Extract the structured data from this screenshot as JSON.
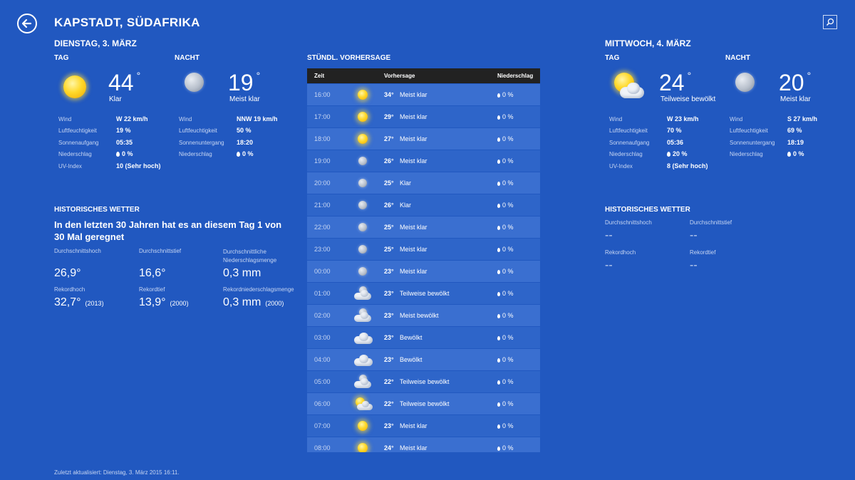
{
  "header": {
    "title": "KAPSTADT, SÜDAFRIKA"
  },
  "today": {
    "date": "DIENSTAG, 3. MÄRZ",
    "day": {
      "label": "TAG",
      "temp": "44",
      "deg": "°",
      "cond": "Klar"
    },
    "night": {
      "label": "NACHT",
      "temp": "19",
      "deg": "°",
      "cond": "Meist klar"
    },
    "day_details": [
      {
        "label": "Wind",
        "value": "W 22 km/h"
      },
      {
        "label": "Luftfeuchtigkeit",
        "value": "19 %"
      },
      {
        "label": "Sonnenaufgang",
        "value": "05:35"
      },
      {
        "label": "Niederschlag",
        "value": "0 %"
      },
      {
        "label": "UV-Index",
        "value": "10 (Sehr hoch)"
      }
    ],
    "night_details": [
      {
        "label": "Wind",
        "value": "NNW 19 km/h"
      },
      {
        "label": "Luftfeuchtigkeit",
        "value": "50 %"
      },
      {
        "label": "Sonnenuntergang",
        "value": "18:20"
      },
      {
        "label": "Niederschlag",
        "value": "0 %"
      }
    ]
  },
  "history": {
    "title": "HISTORISCHES WETTER",
    "headline": "In den letzten 30 Jahren hat es an diesem Tag 1 von 30 Mal geregnet",
    "avg_high": {
      "label": "Durchschnittshoch",
      "value": "26,9°"
    },
    "avg_low": {
      "label": "Durchschnittstief",
      "value": "16,6°"
    },
    "avg_precip": {
      "label": "Durchschnittliche Niederschlagsmenge",
      "value": "0,3 mm"
    },
    "rec_high": {
      "label": "Rekordhoch",
      "value": "32,7°",
      "year": "(2013)"
    },
    "rec_low": {
      "label": "Rekordtief",
      "value": "13,9°",
      "year": "(2000)"
    },
    "rec_precip": {
      "label": "Rekordniederschlagsmenge",
      "value": "0,3 mm",
      "year": "(2000)"
    }
  },
  "hourly": {
    "title": "STÜNDL. VORHERSAGE",
    "cols": {
      "time": "Zeit",
      "forecast": "Vorhersage",
      "precip": "Niederschlag"
    },
    "rows": [
      {
        "time": "16:00",
        "icon": "sun-icon",
        "temp": "34°",
        "cond": "Meist klar",
        "precip": "0 %"
      },
      {
        "time": "17:00",
        "icon": "sun-icon",
        "temp": "29°",
        "cond": "Meist klar",
        "precip": "0 %"
      },
      {
        "time": "18:00",
        "icon": "sun-icon",
        "temp": "27°",
        "cond": "Meist klar",
        "precip": "0 %"
      },
      {
        "time": "19:00",
        "icon": "moon-icon",
        "temp": "26°",
        "cond": "Meist klar",
        "precip": "0 %"
      },
      {
        "time": "20:00",
        "icon": "moon-icon",
        "temp": "25°",
        "cond": "Klar",
        "precip": "0 %"
      },
      {
        "time": "21:00",
        "icon": "moon-icon",
        "temp": "26°",
        "cond": "Klar",
        "precip": "0 %"
      },
      {
        "time": "22:00",
        "icon": "moon-icon",
        "temp": "25°",
        "cond": "Meist klar",
        "precip": "0 %"
      },
      {
        "time": "23:00",
        "icon": "moon-icon",
        "temp": "25°",
        "cond": "Meist klar",
        "precip": "0 %"
      },
      {
        "time": "00:00",
        "icon": "moon-icon",
        "temp": "23°",
        "cond": "Meist klar",
        "precip": "0 %"
      },
      {
        "time": "01:00",
        "icon": "moon-cloud-icon",
        "temp": "23°",
        "cond": "Teilweise bewölkt",
        "precip": "0 %"
      },
      {
        "time": "02:00",
        "icon": "moon-cloud-icon",
        "temp": "23°",
        "cond": "Meist bewölkt",
        "precip": "0 %"
      },
      {
        "time": "03:00",
        "icon": "cloud-icon",
        "temp": "23°",
        "cond": "Bewölkt",
        "precip": "0 %"
      },
      {
        "time": "04:00",
        "icon": "cloud-icon",
        "temp": "23°",
        "cond": "Bewölkt",
        "precip": "0 %"
      },
      {
        "time": "05:00",
        "icon": "moon-cloud-icon",
        "temp": "22°",
        "cond": "Teilweise bewölkt",
        "precip": "0 %"
      },
      {
        "time": "06:00",
        "icon": "sun-cloud-icon",
        "temp": "22°",
        "cond": "Teilweise bewölkt",
        "precip": "0 %"
      },
      {
        "time": "07:00",
        "icon": "sun-icon",
        "temp": "23°",
        "cond": "Meist klar",
        "precip": "0 %"
      },
      {
        "time": "08:00",
        "icon": "sun-icon",
        "temp": "24°",
        "cond": "Meist klar",
        "precip": "0 %"
      }
    ]
  },
  "tomorrow": {
    "date": "MITTWOCH, 4. MÄRZ",
    "day": {
      "label": "TAG",
      "temp": "24",
      "deg": "°",
      "cond": "Teilweise bewölkt"
    },
    "night": {
      "label": "NACHT",
      "temp": "20",
      "deg": "°",
      "cond": "Meist klar"
    },
    "day_details": [
      {
        "label": "Wind",
        "value": "W 23 km/h"
      },
      {
        "label": "Luftfeuchtigkeit",
        "value": "70 %"
      },
      {
        "label": "Sonnenaufgang",
        "value": "05:36"
      },
      {
        "label": "Niederschlag",
        "value": "20 %"
      },
      {
        "label": "UV-Index",
        "value": "8 (Sehr hoch)"
      }
    ],
    "night_details": [
      {
        "label": "Wind",
        "value": "S 27 km/h"
      },
      {
        "label": "Luftfeuchtigkeit",
        "value": "69 %"
      },
      {
        "label": "Sonnenuntergang",
        "value": "18:19"
      },
      {
        "label": "Niederschlag",
        "value": "0 %"
      }
    ]
  },
  "history2": {
    "title": "HISTORISCHES WETTER",
    "avg_high": {
      "label": "Durchschnittshoch",
      "value": "--"
    },
    "avg_low": {
      "label": "Durchschnittstief",
      "value": "--"
    },
    "rec_high": {
      "label": "Rekordhoch",
      "value": "--"
    },
    "rec_low": {
      "label": "Rekordtief",
      "value": "--"
    }
  },
  "footer": {
    "updated": "Zuletzt aktualisiert: Dienstag, 3. März 2015 16:11."
  },
  "colors": {
    "background": "#2158c0",
    "row_odd": "#3a6fd0",
    "row_even": "#2e65c9",
    "table_head": "#222222"
  }
}
